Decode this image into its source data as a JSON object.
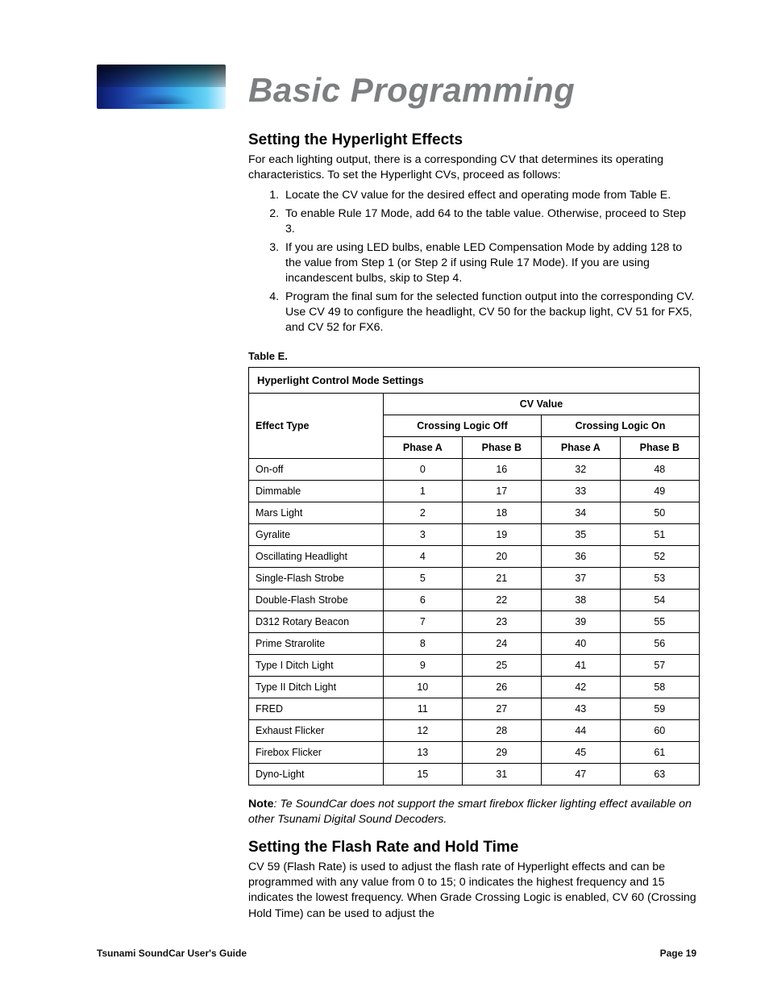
{
  "page_title": "Basic Programming",
  "section1": {
    "heading": "Setting the Hyperlight Effects",
    "intro": "For each lighting output, there is a corresponding CV that determines its operating characteristics. To set the Hyperlight CVs, proceed as follows:",
    "steps": [
      "Locate the CV value for the desired effect and operating mode from Table E.",
      "To enable Rule 17 Mode, add 64 to the table value. Otherwise, proceed to Step 3.",
      "If you are using LED bulbs, enable LED Compensation Mode by adding 128 to the value from Step 1 (or Step 2 if using Rule 17 Mode). If you are using incandescent bulbs, skip to Step 4.",
      "Program the final sum for the selected function output into the corresponding CV. Use CV 49 to configure the headlight, CV 50 for the backup light, CV 51 for FX5, and CV 52 for FX6."
    ]
  },
  "table": {
    "label": "Table E.",
    "title": "Hyperlight Control Mode Settings",
    "col_effect": "Effect Type",
    "col_cv_value": "CV Value",
    "col_off": "Crossing Logic Off",
    "col_on": "Crossing Logic On",
    "col_phase_a": "Phase A",
    "col_phase_b": "Phase B",
    "rows": [
      {
        "name": "On-off",
        "off_a": "0",
        "off_b": "16",
        "on_a": "32",
        "on_b": "48"
      },
      {
        "name": "Dimmable",
        "off_a": "1",
        "off_b": "17",
        "on_a": "33",
        "on_b": "49"
      },
      {
        "name": "Mars Light",
        "off_a": "2",
        "off_b": "18",
        "on_a": "34",
        "on_b": "50"
      },
      {
        "name": "Gyralite",
        "off_a": "3",
        "off_b": "19",
        "on_a": "35",
        "on_b": "51"
      },
      {
        "name": "Oscillating Headlight",
        "off_a": "4",
        "off_b": "20",
        "on_a": "36",
        "on_b": "52"
      },
      {
        "name": "Single-Flash Strobe",
        "off_a": "5",
        "off_b": "21",
        "on_a": "37",
        "on_b": "53"
      },
      {
        "name": "Double-Flash Strobe",
        "off_a": "6",
        "off_b": "22",
        "on_a": "38",
        "on_b": "54"
      },
      {
        "name": "D312 Rotary Beacon",
        "off_a": "7",
        "off_b": "23",
        "on_a": "39",
        "on_b": "55"
      },
      {
        "name": "Prime Strarolite",
        "off_a": "8",
        "off_b": "24",
        "on_a": "40",
        "on_b": "56"
      },
      {
        "name": "Type I Ditch Light",
        "off_a": "9",
        "off_b": "25",
        "on_a": "41",
        "on_b": "57"
      },
      {
        "name": "Type II Ditch Light",
        "off_a": "10",
        "off_b": "26",
        "on_a": "42",
        "on_b": "58"
      },
      {
        "name": "FRED",
        "off_a": "11",
        "off_b": "27",
        "on_a": "43",
        "on_b": "59"
      },
      {
        "name": "Exhaust Flicker",
        "off_a": "12",
        "off_b": "28",
        "on_a": "44",
        "on_b": "60"
      },
      {
        "name": "Firebox Flicker",
        "off_a": "13",
        "off_b": "29",
        "on_a": "45",
        "on_b": "61"
      },
      {
        "name": "Dyno-Light",
        "off_a": "15",
        "off_b": "31",
        "on_a": "47",
        "on_b": "63"
      }
    ]
  },
  "note": {
    "label": "Note",
    "text": "Te SoundCar does not support the smart firebox flicker lighting effect available on other Tsunami Digital Sound Decoders."
  },
  "section2": {
    "heading": "Setting the Flash Rate and Hold Time",
    "body": "CV 59 (Flash Rate) is used to adjust the flash rate of Hyperlight effects and can be programmed with any value from 0 to 15; 0 indicates the highest frequency and 15 indicates the lowest frequency. When Grade Crossing Logic is enabled, CV 60 (Crossing Hold Time) can be used to adjust the"
  },
  "footer": {
    "left": "Tsunami SoundCar User's Guide",
    "right": "Page 19"
  }
}
